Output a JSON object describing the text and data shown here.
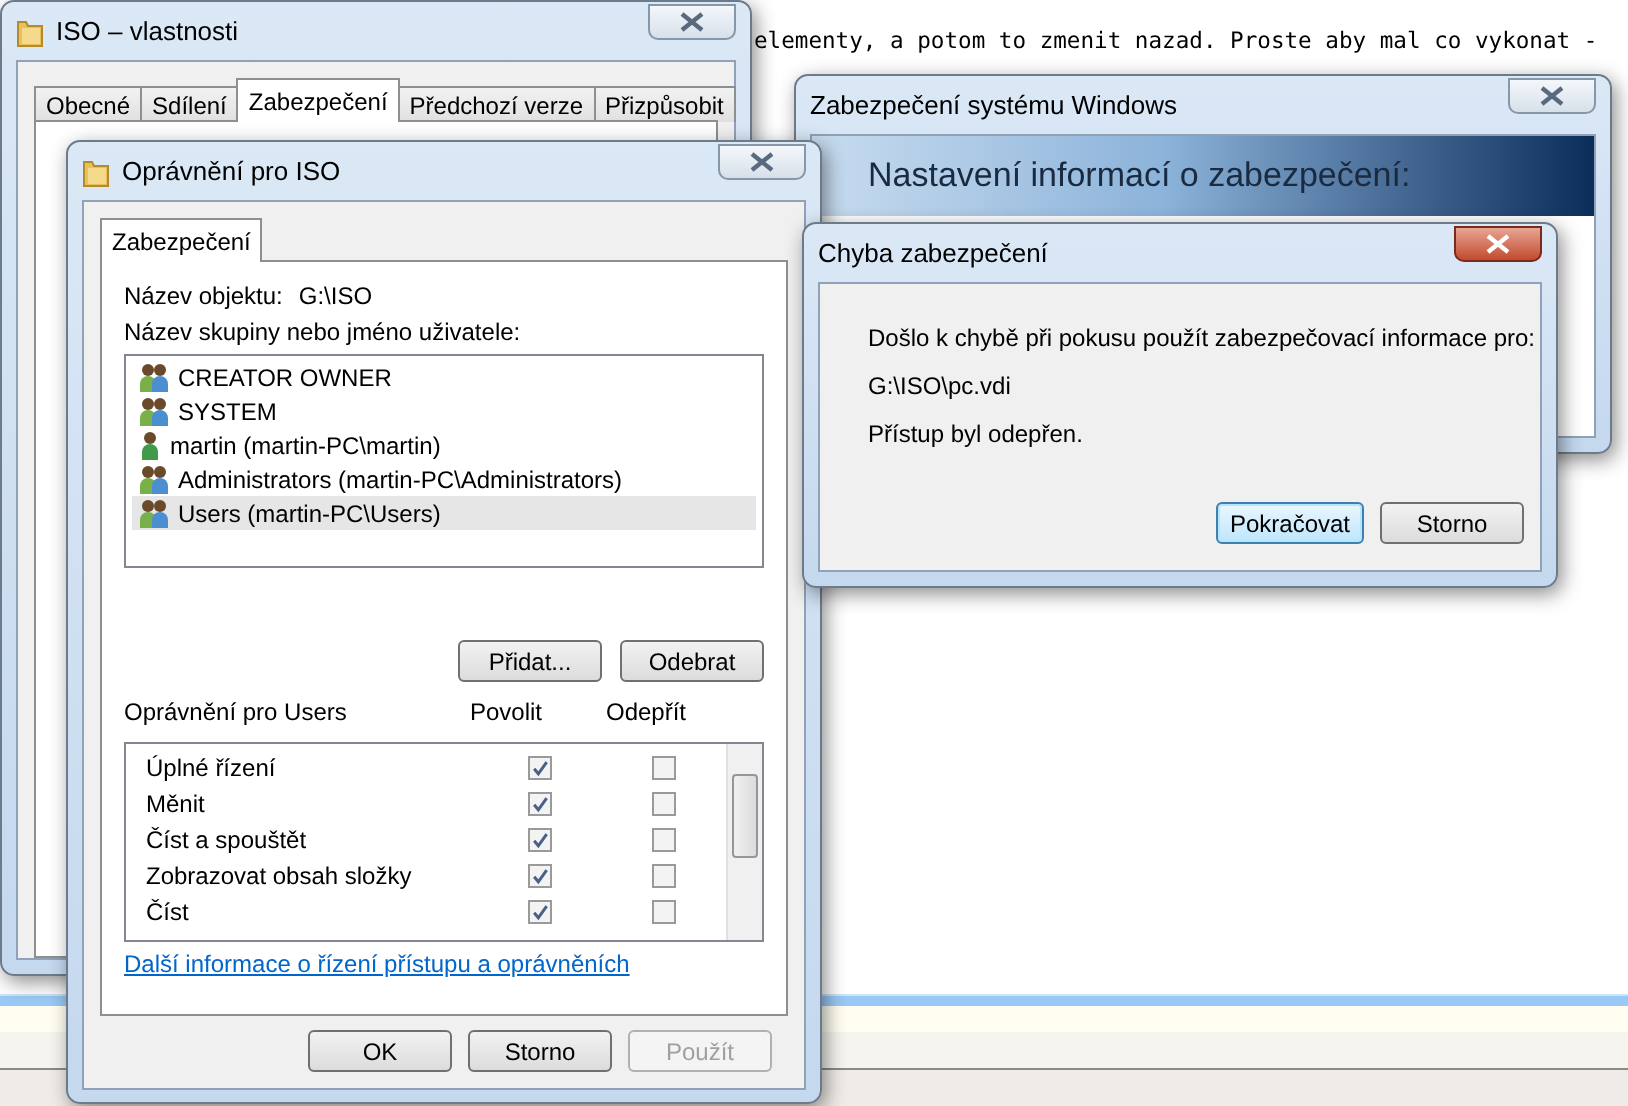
{
  "background_text": "elementy, a potom to zmenit nazad. Proste aby mal co vykonat -",
  "properties_window": {
    "title": "ISO – vlastnosti",
    "active": false,
    "tabs": [
      {
        "label": "Obecné",
        "selected": false
      },
      {
        "label": "Sdílení",
        "selected": false
      },
      {
        "label": "Zabezpečení",
        "selected": true
      },
      {
        "label": "Předchozí verze",
        "selected": false
      },
      {
        "label": "Přizpůsobit",
        "selected": false
      }
    ]
  },
  "permissions_window": {
    "title": "Oprávnění pro ISO",
    "active": false,
    "tabs": [
      {
        "label": "Zabezpečení",
        "selected": true
      }
    ],
    "object_label": "Název objektu:",
    "object_value": "G:\\ISO",
    "principals_label": "Název skupiny nebo jméno uživatele:",
    "principals": [
      {
        "name": "CREATOR OWNER",
        "kind": "group",
        "selected": false
      },
      {
        "name": "SYSTEM",
        "kind": "group",
        "selected": false
      },
      {
        "name": "martin (martin-PC\\martin)",
        "kind": "user",
        "selected": false
      },
      {
        "name": "Administrators (martin-PC\\Administrators)",
        "kind": "group",
        "selected": false
      },
      {
        "name": "Users (martin-PC\\Users)",
        "kind": "group",
        "selected": true
      }
    ],
    "add_button": "Přidat...",
    "remove_button": "Odebrat",
    "permissions_label": "Oprávnění pro Users",
    "allow_header": "Povolit",
    "deny_header": "Odepřít",
    "permissions": [
      {
        "name": "Úplné řízení",
        "allow": true,
        "deny": false
      },
      {
        "name": "Měnit",
        "allow": true,
        "deny": false
      },
      {
        "name": "Číst a spouštět",
        "allow": true,
        "deny": false
      },
      {
        "name": "Zobrazovat obsah složky",
        "allow": true,
        "deny": false
      },
      {
        "name": "Číst",
        "allow": true,
        "deny": false
      }
    ],
    "link": "Další informace o řízení přístupu a oprávněních",
    "buttons": [
      {
        "label": "OK",
        "disabled": false
      },
      {
        "label": "Storno",
        "disabled": false
      },
      {
        "label": "Použít",
        "disabled": true
      }
    ]
  },
  "security_window": {
    "title": "Zabezpečení systému Windows",
    "active": false,
    "heading": "Nastavení informací o zabezpečení:"
  },
  "error_dialog": {
    "title": "Chyba zabezpečení",
    "active": true,
    "message": "Došlo k chybě při pokusu použít zabezpečovací informace pro:",
    "path": "G:\\ISO\\pc.vdi",
    "detail": "Přístup byl odepřen.",
    "buttons": [
      {
        "label": "Pokračovat",
        "default": true
      },
      {
        "label": "Storno",
        "default": false
      }
    ]
  }
}
